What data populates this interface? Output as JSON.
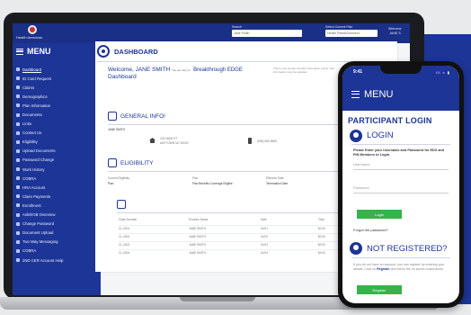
{
  "laptop": {
    "brand": "Health American",
    "search_label": "Search",
    "search_value": "Jane Smith",
    "plan_label": "Select Current Plan",
    "plan_value": "Health Reimbursement",
    "welcome_top": "Welcome",
    "welcome_top_name": "JANE S.",
    "menu_title": "MENU",
    "sidebar": [
      {
        "label": "Dashboard",
        "icon": "dashboard-icon",
        "active": true
      },
      {
        "label": "ID Card Request",
        "icon": "id-card-icon"
      },
      {
        "label": "Claims",
        "icon": "claims-icon"
      },
      {
        "label": "Demographics",
        "icon": "demographics-icon"
      },
      {
        "label": "Plan Information",
        "icon": "plan-icon"
      },
      {
        "label": "Documents",
        "icon": "documents-icon"
      },
      {
        "label": "Links",
        "icon": "link-icon"
      },
      {
        "label": "Contact Us",
        "icon": "contact-icon"
      },
      {
        "label": "Eligibility",
        "icon": "eligibility-icon"
      },
      {
        "label": "Upload Documents",
        "icon": "upload-icon"
      },
      {
        "label": "Password Change",
        "icon": "lock-icon"
      },
      {
        "label": "Work History",
        "icon": "work-icon"
      },
      {
        "label": "COBRA",
        "icon": "cobra-icon"
      },
      {
        "label": "HRA Account",
        "icon": "hra-icon"
      },
      {
        "label": "Claim Payments",
        "icon": "payment-icon"
      },
      {
        "label": "Enrollment",
        "icon": "enroll-icon"
      },
      {
        "label": "Ask/EOB Overview",
        "icon": "eob-icon"
      },
      {
        "label": "Change Password",
        "icon": "key-icon"
      },
      {
        "label": "Document Upload",
        "icon": "doc-upload-icon"
      },
      {
        "label": "Two Way Messaging",
        "icon": "message-icon"
      },
      {
        "label": "COBRA",
        "icon": "cobra-icon"
      },
      {
        "label": "2ND CER Account Help",
        "icon": "help-icon"
      }
    ],
    "dashboard_title": "DASHBOARD",
    "welcome_prefix": "Welcome,",
    "welcome_name": "JANE SMITH",
    "welcome_sub": "Dashboard",
    "welcome_small": "You are user of",
    "welcome_company": "Breakthrough EDGE",
    "welcome_note": "This is your secure benefits information portal. Your information may be updated.",
    "general_info_title": "GENERAL INFO!",
    "member_name": "JANE SMITH",
    "address_line1": "123 MAIN ST",
    "address_line2": "ANYTOWN NC 00000",
    "phone_value": "(555) 555-5555",
    "eligibility_title": "ELIGIBILITY",
    "elig_headers": [
      "Current Eligibility",
      "Plan",
      "Effective Date",
      "Term"
    ],
    "elig_row": [
      "Plan",
      "Plan Benefits Coverage Eligible",
      "Termination Date",
      ""
    ],
    "table_headers": [
      "Claim Number",
      "Provider Name",
      "Date",
      "Total"
    ],
    "table_rows": [
      [
        "CL-0001",
        "JANE SMITH",
        "01/01",
        "$0.00"
      ],
      [
        "CL-0002",
        "JANE SMITH",
        "01/02",
        "$0.00"
      ],
      [
        "CL-0003",
        "JANE SMITH",
        "01/03",
        "$0.00"
      ],
      [
        "CL-0004",
        "JANE SMITH",
        "01/04",
        "$0.00"
      ]
    ]
  },
  "phone": {
    "time": "9:41",
    "status": "lll ≈ ▮",
    "menu_title": "MENU",
    "page_title": "PARTICIPANT LOGIN",
    "login_title": "LOGIN",
    "instructions": "Please Enter your Username and Password for EDX and PIN Members to Login.",
    "username_placeholder": "Username",
    "password_placeholder": "Password",
    "login_button": "Login",
    "forgot": "Forgot the password?",
    "register_title": "NOT REGISTERED?",
    "register_text_before": "If you do not have an account, you can register by entering your details. Click on",
    "register_link": "Register",
    "register_text_after": "and follow the on screen instructions.",
    "register_button": "Register"
  },
  "colors": {
    "brand_blue": "#1d3596",
    "accent_green": "#36b34a",
    "logo_red": "#c93030"
  }
}
